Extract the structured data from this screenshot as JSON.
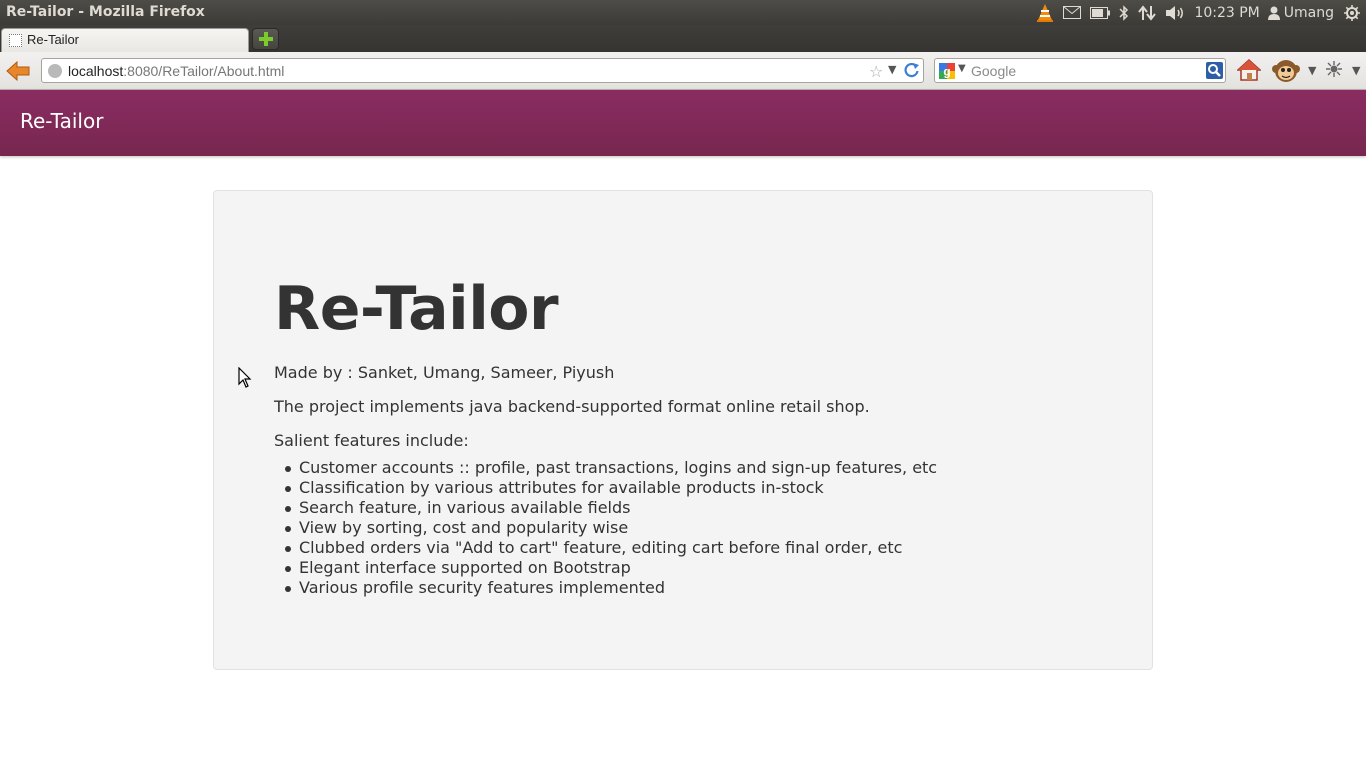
{
  "window": {
    "title": "Re-Tailor - Mozilla Firefox",
    "clock": "10:23 PM",
    "user": "Umang"
  },
  "browser": {
    "tab_title": "Re-Tailor",
    "url_host": "localhost",
    "url_rest": ":8080/ReTailor/About.html",
    "search_placeholder": "Google"
  },
  "site": {
    "brand": "Re-Tailor",
    "brand_color": "#802a5a"
  },
  "about": {
    "title": "Re-Tailor",
    "made_by": "Made by : Sanket, Umang, Sameer, Piyush",
    "description": "The project implements java backend-supported format online retail shop.",
    "features_heading": "Salient features include:",
    "features": [
      "Customer accounts :: profile, past transactions, logins and sign-up features, etc",
      "Classification by various attributes for available products in-stock",
      "Search feature, in various available fields",
      "View by sorting, cost and popularity wise",
      "Clubbed orders via \"Add to cart\" feature, editing cart before final order, etc",
      "Elegant interface supported on Bootstrap",
      "Various profile security features implemented"
    ]
  },
  "icons": {
    "panel": [
      "vlc-icon",
      "mail-icon",
      "battery-icon",
      "bluetooth-icon",
      "network-icon",
      "volume-icon",
      "user-icon",
      "power-icon"
    ],
    "nav": [
      "back-arrow-icon",
      "site-identity-icon",
      "bookmark-star-icon",
      "reload-icon",
      "google-icon",
      "search-icon",
      "home-icon",
      "monkey-addon-icon",
      "extension-icon"
    ]
  }
}
